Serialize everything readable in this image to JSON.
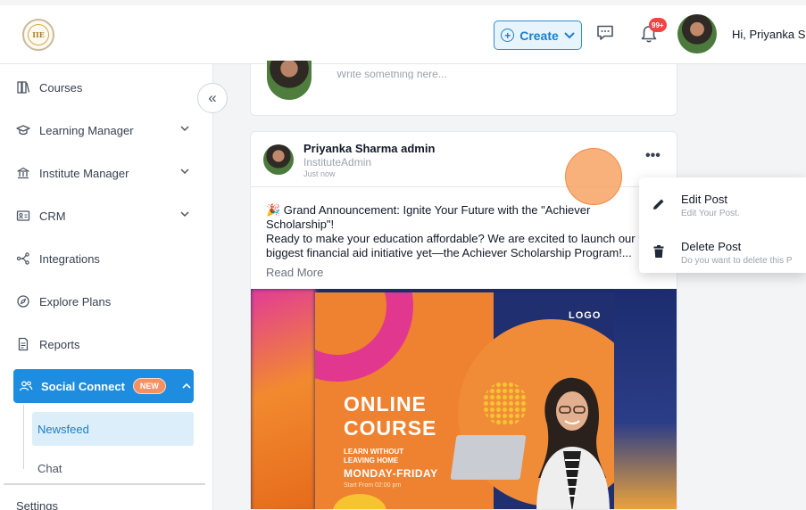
{
  "header": {
    "logo_text": "IIE",
    "create_label": "Create",
    "badge_count": "99+",
    "greeting": "Hi, Priyanka Sh"
  },
  "sidebar": {
    "items": [
      {
        "label": "Courses",
        "icon": "book-icon",
        "expandable": false
      },
      {
        "label": "Learning Manager",
        "icon": "graduation-cap-icon",
        "expandable": true
      },
      {
        "label": "Institute Manager",
        "icon": "building-icon",
        "expandable": true
      },
      {
        "label": "CRM",
        "icon": "id-card-icon",
        "expandable": true
      },
      {
        "label": "Integrations",
        "icon": "nodes-icon",
        "expandable": false
      },
      {
        "label": "Explore Plans",
        "icon": "compass-icon",
        "expandable": false
      },
      {
        "label": "Reports",
        "icon": "document-icon",
        "expandable": false
      }
    ],
    "active": {
      "label": "Social Connect",
      "badge": "NEW",
      "icon": "users-icon"
    },
    "subitems": [
      {
        "label": "Newsfeed",
        "active": true
      },
      {
        "label": "Chat",
        "active": false
      }
    ],
    "bottom_label": "Settings",
    "collapse_glyph": "«"
  },
  "composer": {
    "placeholder": "Write something here..."
  },
  "post": {
    "author": "Priyanka Sharma admin",
    "role": "InstituteAdmin",
    "time": "Just now",
    "more_glyph": "•••",
    "body_line1": "🎉 Grand Announcement: Ignite Your Future with the \"Achiever Scholarship\"!",
    "body_line2": "Ready to make your education affordable? We are excited to launch our biggest financial aid initiative yet—the Achiever Scholarship Program!...",
    "read_more": "Read More",
    "image": {
      "logo": "LOGO",
      "title_line1": "ONLINE",
      "title_line2": "COURSE",
      "subtitle_line1": "LEARN WITHOUT",
      "subtitle_line2": "LEAVING HOME",
      "days": "MONDAY-FRIDAY",
      "start": "Start From 02:00 pm"
    }
  },
  "menu": {
    "items": [
      {
        "title": "Edit Post",
        "subtitle": "Edit Your Post.",
        "icon": "pencil-icon"
      },
      {
        "title": "Delete Post",
        "subtitle": "Do you want to delete this P",
        "icon": "trash-icon"
      }
    ]
  },
  "colors": {
    "primary": "#1e8de0",
    "new_badge": "#f59062",
    "notification": "#ef4444",
    "banner_orange": "#ee8230",
    "banner_navy": "#1f2f6f"
  }
}
